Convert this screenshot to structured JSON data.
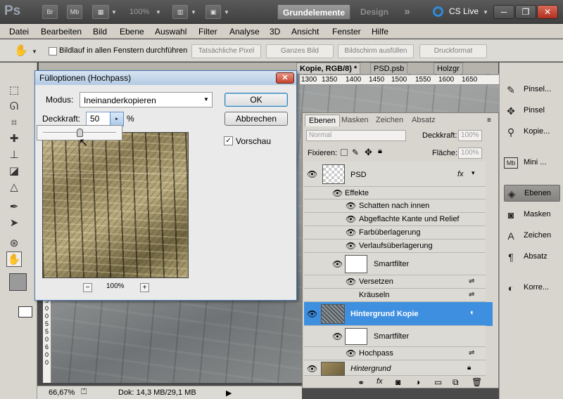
{
  "appbar": {
    "logo": "Ps",
    "bridge_icon": "Br",
    "minibridge_icon": "Mb",
    "zoom": "100%",
    "workspace_active": "Grundelemente",
    "workspace_other": "Design",
    "more": "»",
    "cs_live": "CS Live",
    "window_buttons": [
      "─",
      "❐",
      "✕"
    ]
  },
  "menu": [
    "Datei",
    "Bearbeiten",
    "Bild",
    "Ebene",
    "Auswahl",
    "Filter",
    "Analyse",
    "3D",
    "Ansicht",
    "Fenster",
    "Hilfe"
  ],
  "options": {
    "scroll_all": "Bildlauf in allen Fenstern durchführen",
    "buttons": [
      "Tatsächliche Pixel",
      "Ganzes Bild",
      "Bildschirm ausfüllen",
      "Druckformat"
    ]
  },
  "doc_tabs": [
    "Kopie, RGB/8) *",
    "PSD.psb",
    "Holzgr"
  ],
  "ruler_top": [
    "1300",
    "1350",
    "1400",
    "1450",
    "1500",
    "1550",
    "1600",
    "1650"
  ],
  "ruler_left": [
    "5",
    "0",
    "0",
    "5",
    "5",
    "0",
    "6",
    "0",
    "0"
  ],
  "status": {
    "zoom": "66,67%",
    "doc": "Dok: 14,3 MB/29,1 MB"
  },
  "dock": [
    {
      "label": "Pinsel...",
      "icon": "brush-icon"
    },
    {
      "label": "Pinsel",
      "icon": "brush-presets-icon"
    },
    {
      "label": "Kopie...",
      "icon": "clone-source-icon"
    },
    {
      "label": "Mini ...",
      "icon": "mini-bridge-icon"
    },
    {
      "label": "Ebenen",
      "icon": "layers-icon"
    },
    {
      "label": "Masken",
      "icon": "masks-icon"
    },
    {
      "label": "Zeichen",
      "icon": "character-icon"
    },
    {
      "label": "Absatz",
      "icon": "paragraph-icon"
    },
    {
      "label": "Korre...",
      "icon": "adjustments-icon"
    }
  ],
  "layers_panel": {
    "tabs": [
      "Ebenen",
      "Masken",
      "Zeichen",
      "Absatz"
    ],
    "blend_mode": "Normal",
    "opacity_label": "Deckkraft:",
    "opacity_value": "100%",
    "lock_label": "Fixieren:",
    "fill_label": "Fläche:",
    "fill_value": "100%",
    "rows": [
      {
        "name": "PSD",
        "type": "layer"
      },
      {
        "name": "Effekte",
        "type": "group"
      },
      {
        "name": "Schatten nach innen",
        "type": "effect"
      },
      {
        "name": "Abgeflachte Kante und Relief",
        "type": "effect"
      },
      {
        "name": "Farbüberlagerung",
        "type": "effect"
      },
      {
        "name": "Verlaufsüberlagerung",
        "type": "effect"
      },
      {
        "name": "Smartfilter",
        "type": "smartfilter"
      },
      {
        "name": "Versetzen",
        "type": "filter"
      },
      {
        "name": "Kräuseln",
        "type": "filter"
      },
      {
        "name": "Hintergrund Kopie",
        "type": "layer-selected"
      },
      {
        "name": "Smartfilter",
        "type": "smartfilter"
      },
      {
        "name": "Hochpass",
        "type": "filter"
      },
      {
        "name": "Hintergrund",
        "type": "layer-locked"
      }
    ]
  },
  "dialog": {
    "title": "Fülloptionen (Hochpass)",
    "mode_label": "Modus:",
    "mode_value": "Ineinanderkopieren",
    "opacity_label": "Deckkraft:",
    "opacity_value": "50",
    "opacity_unit": "%",
    "ok": "OK",
    "cancel": "Abbrechen",
    "preview_label": "Vorschau",
    "preview_checked": true,
    "zoom_minus": "−",
    "zoom_value": "100%",
    "zoom_plus": "+",
    "slider_value_percent": 50
  },
  "colors": {
    "selected_layer": "#3f8fe0",
    "dialog_border": "#4a7ab0"
  }
}
